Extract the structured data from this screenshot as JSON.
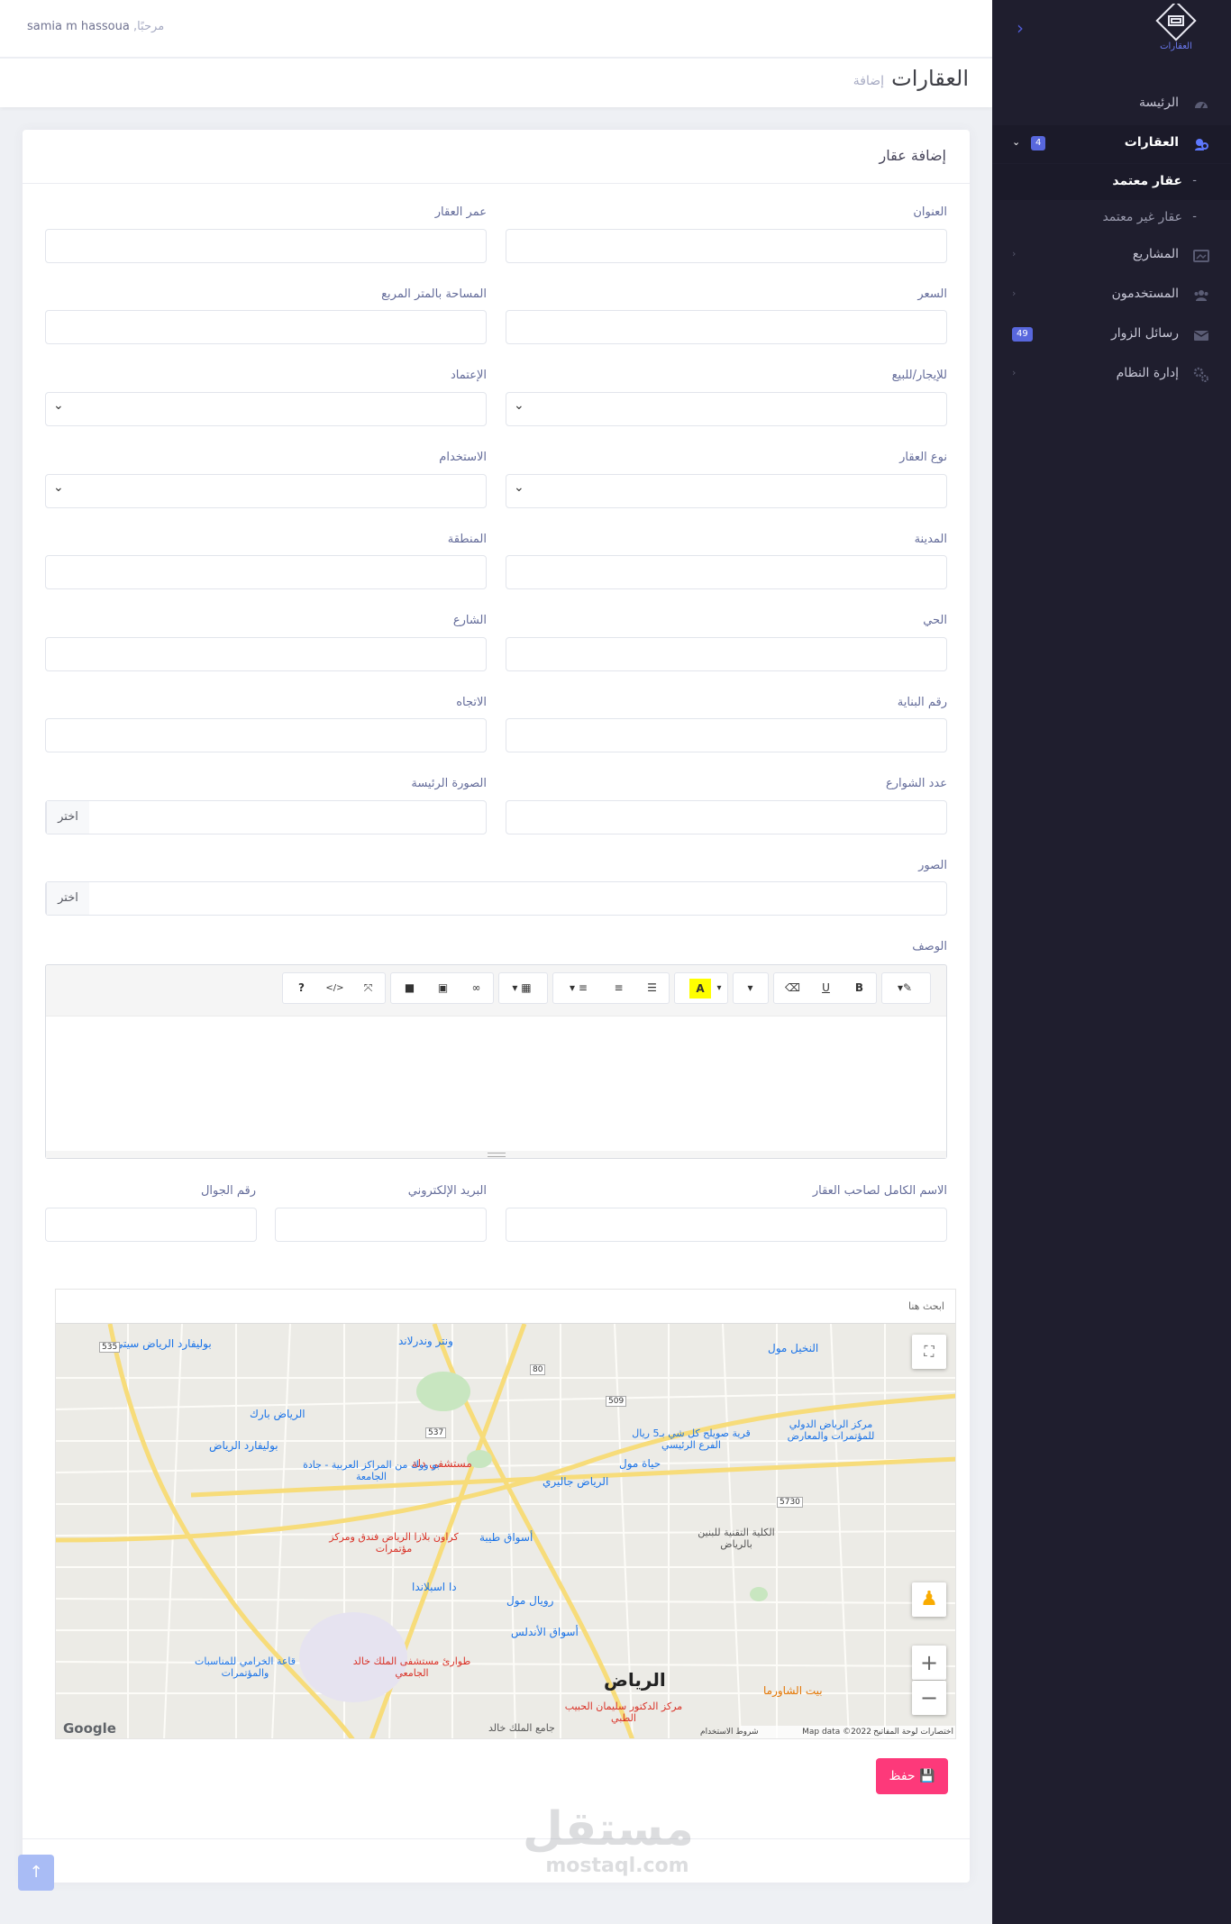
{
  "sidebar": {
    "logo_text": "العقارات",
    "items": [
      {
        "label": "الرئيسة",
        "icon": "dashboard-icon"
      },
      {
        "label": "العقارات",
        "icon": "properties-icon",
        "badge": "4"
      },
      {
        "label": "المشاريع",
        "icon": "projects-icon"
      },
      {
        "label": "المستخدمون",
        "icon": "users-icon"
      },
      {
        "label": "رسائل الزوار",
        "icon": "mail-icon",
        "badge": "49"
      },
      {
        "label": "إدارة النظام",
        "icon": "settings-icon"
      }
    ],
    "sub_items": [
      {
        "label": "عقار معتمد"
      },
      {
        "label": "عقار غير معتمد"
      }
    ]
  },
  "topbar": {
    "greeting": "مرحبًا,",
    "user": "samia m hassoua"
  },
  "subheader": {
    "title": "العقارات",
    "breadcrumb": "إضافة"
  },
  "form": {
    "title": "إضافة عقار",
    "labels": {
      "address": "العنوان",
      "age": "عمر العقار",
      "price": "السعر",
      "area": "المساحة بالمتر المربع",
      "rent_sale": "للإيجار/للبيع",
      "approval": "الإعتماد",
      "type": "نوع العقار",
      "usage": "الاستخدام",
      "city": "المدينة",
      "region": "المنطقة",
      "district": "الحي",
      "street": "الشارع",
      "building_no": "رقم البناية",
      "direction": "الاتجاه",
      "streets_count": "عدد الشوارع",
      "main_image": "الصورة الرئيسة",
      "images": "الصور",
      "description": "الوصف",
      "owner_name": "الاسم الكامل لصاحب العقار",
      "email": "البريد الإلكتروني",
      "mobile": "رقم الجوال"
    },
    "file_button": "اختر",
    "save_button": "حفظ"
  },
  "editor": {
    "toolbar": [
      "magic",
      "B",
      "U",
      "eraser",
      "font-size",
      "A",
      "ul",
      "ol",
      "align",
      "table",
      "link",
      "picture",
      "video",
      "fullscreen",
      "code",
      "?"
    ]
  },
  "map": {
    "search_placeholder": "ابحث هنا",
    "labels": [
      "الرياض",
      "بوليفارد الرياض سيتي",
      "الرياض بارك",
      "بوليفارد الرياض",
      "مستشفى دلة",
      "الرياض جاليري",
      "حياة مول",
      "قرية صويلح كل شي بـ5 ريال الفرع الرئيسي",
      "النخيل مول",
      "مركز الرياض الدولي للمؤتمرات والمعارض",
      "الكلية التقنية للبنين بالرياض",
      "أسواق طيبة",
      "رويال مول",
      "أسواق الأندلس",
      "دا اسبلاندا",
      "كراون بلازا الرياض فندق ومركز مؤتمرات",
      "طوارئ مستشفى الملك خالد الجامعي",
      "قاعة الخرامي للمناسبات والمؤتمرات",
      "بيت الشاورما",
      "مركز الدكتور سليمان الحبيب الطبي",
      "ونتر وندرلاند",
      "بو ووك من المراكز العربية - جادة الجامعة",
      "جامع الملك خالد"
    ],
    "roads": [
      "535",
      "537",
      "80",
      "509",
      "5730"
    ],
    "attribution": "Map data ©2022",
    "terms": "شروط الاستخدام",
    "shortcuts": "اختصارات لوحة المفاتيح",
    "brand": "Google"
  },
  "watermark": {
    "ar": "مستقل",
    "en": "mostaql.com"
  },
  "colors": {
    "sidebar": "#1f1e2e",
    "accent": "#5867dd",
    "save": "#fd397a"
  }
}
